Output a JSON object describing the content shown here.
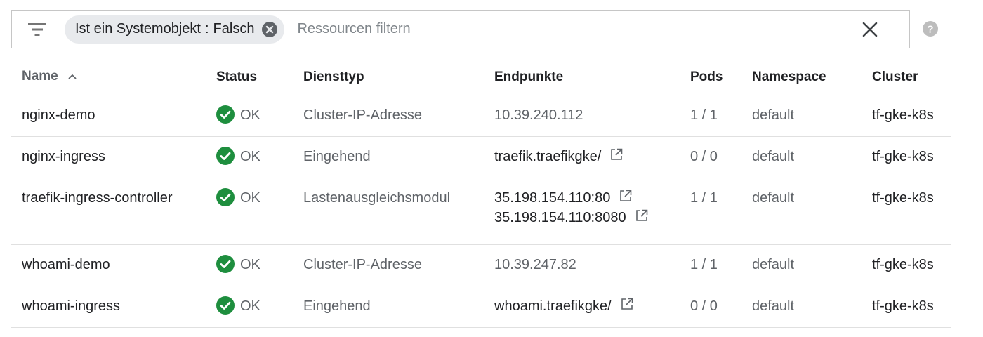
{
  "filter": {
    "chip": {
      "key": "Ist ein Systemobjekt",
      "separator": ":",
      "value": "Falsch"
    },
    "placeholder": "Ressourcen filtern"
  },
  "table": {
    "columns": {
      "name": "Name",
      "status": "Status",
      "type": "Diensttyp",
      "endpoints": "Endpunkte",
      "pods": "Pods",
      "namespace": "Namespace",
      "cluster": "Cluster"
    },
    "sort": {
      "column": "Name",
      "direction": "ascending"
    },
    "rows": [
      {
        "name": "nginx-demo",
        "status": "OK",
        "type": "Cluster-IP-Adresse",
        "endpoints": [
          {
            "text": "10.39.240.112",
            "link": false
          }
        ],
        "pods": "1 / 1",
        "namespace": "default",
        "cluster": "tf-gke-k8s"
      },
      {
        "name": "nginx-ingress",
        "status": "OK",
        "type": "Eingehend",
        "endpoints": [
          {
            "text": "traefik.traefikgke/",
            "link": true
          }
        ],
        "pods": "0 / 0",
        "namespace": "default",
        "cluster": "tf-gke-k8s"
      },
      {
        "name": "traefik-ingress-controller",
        "status": "OK",
        "type": "Lastenausgleichsmodul",
        "endpoints": [
          {
            "text": "35.198.154.110:80",
            "link": true
          },
          {
            "text": "35.198.154.110:8080",
            "link": true
          }
        ],
        "pods": "1 / 1",
        "namespace": "default",
        "cluster": "tf-gke-k8s"
      },
      {
        "name": "whoami-demo",
        "status": "OK",
        "type": "Cluster-IP-Adresse",
        "endpoints": [
          {
            "text": "10.39.247.82",
            "link": false
          }
        ],
        "pods": "1 / 1",
        "namespace": "default",
        "cluster": "tf-gke-k8s"
      },
      {
        "name": "whoami-ingress",
        "status": "OK",
        "type": "Eingehend",
        "endpoints": [
          {
            "text": "whoami.traefikgke/",
            "link": true
          }
        ],
        "pods": "0 / 0",
        "namespace": "default",
        "cluster": "tf-gke-k8s"
      }
    ]
  },
  "icons": {
    "filter": "filter-list-icon",
    "chip_remove": "cancel-circle-icon",
    "clear": "close-icon",
    "help": "help-circle-icon",
    "sort": "chevron-up-icon",
    "status_ok": "check-circle-icon",
    "external_link": "external-link-icon"
  },
  "colors": {
    "ok_green": "#1e8e3e",
    "chip_bg": "#e8eaed",
    "border": "#c6c6c6",
    "muted_text": "#5f6368"
  }
}
